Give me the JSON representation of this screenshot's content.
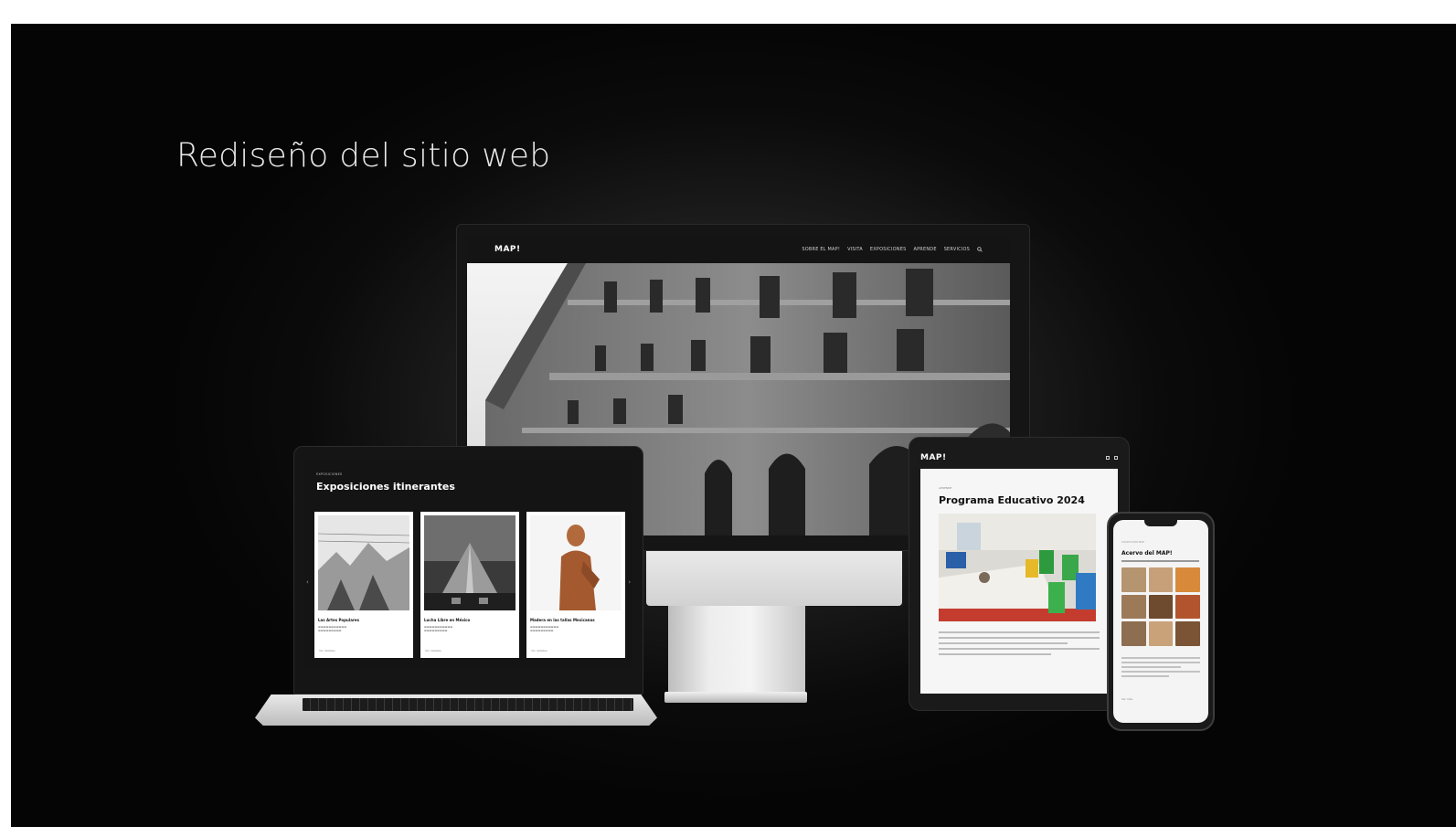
{
  "headline": "Rediseño del sitio web",
  "desktop": {
    "logo": "MAP!",
    "menu": [
      "SOBRE EL MAP!",
      "VISITA",
      "EXPOSICIONES",
      "APRENDE",
      "SERVICIOS"
    ],
    "search_icon": "search-icon",
    "hero_image": "building-facade-photo"
  },
  "laptop": {
    "breadcrumb": "EXPOSICIONES",
    "title": "Exposiciones itinerantes",
    "cards": [
      {
        "title": "Las Artes Populares",
        "link": "Ver detalles"
      },
      {
        "title": "Lucha Libre en México",
        "link": "Ver detalles"
      },
      {
        "title": "Madera en las tallas Mexicanas",
        "link": "Ver detalles"
      }
    ],
    "arrow_left": "‹",
    "arrow_right": "›"
  },
  "tablet": {
    "logo": "MAP!",
    "breadcrumb": "APRENDE",
    "title": "Programa Educativo 2024"
  },
  "phone": {
    "breadcrumb": "COLECCIÓN MAP",
    "title": "Acervo del MAP!",
    "link": "Ver más"
  },
  "colors": {
    "background": "#0b0b0b",
    "headline": "#e8e8e8",
    "screen_dark": "#141414",
    "screen_light": "#f6f6f6"
  }
}
